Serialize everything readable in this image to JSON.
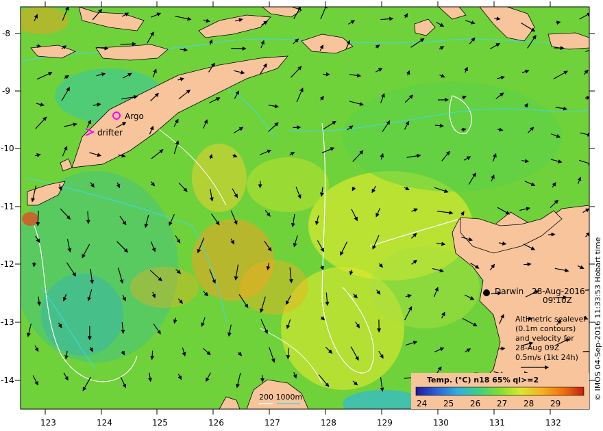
{
  "map": {
    "lon_ticks": [
      "123",
      "124",
      "125",
      "126",
      "127",
      "128",
      "129",
      "130",
      "131",
      "132"
    ],
    "lat_ticks": [
      "-8",
      "-9",
      "-10",
      "-11",
      "-12",
      "-13",
      "-14"
    ]
  },
  "labels": {
    "argo": "Argo",
    "drifter": "drifter",
    "darwin": "Darwin",
    "date": "28-Aug-2016",
    "time": "09:10Z"
  },
  "legend_box": {
    "lines": [
      "Altimetric sealevel",
      "(0.1m contours)",
      "and velocity for",
      "28-Aug 09Z",
      "0.5m/s (1kt 24h)"
    ]
  },
  "colorbar": {
    "title": "Temp. (°C) n18 65% ql>=2",
    "ticks": [
      "24",
      "25",
      "26",
      "27",
      "28",
      "29"
    ],
    "colors": [
      "#1a1aa0",
      "#2a5fd4",
      "#2fb0e0",
      "#3fd080",
      "#7fe030",
      "#d8e830",
      "#f8b020",
      "#f07010",
      "#c02010"
    ]
  },
  "scale_bar": {
    "label": "200  1000m"
  },
  "credit": "© IMOS 04-Sep-2016 11:33:53 Hobart time",
  "colors": {
    "land": "#f7c49b",
    "sea_bg": "#6fd23a",
    "contour_white": "#ffffff",
    "contour_cyan": "#40d8e8",
    "marker_magenta": "#ff00ff"
  }
}
